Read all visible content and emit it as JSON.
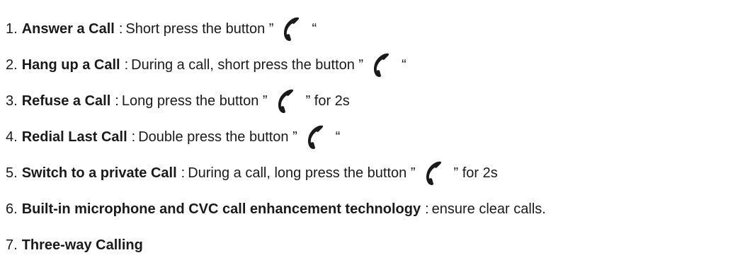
{
  "items": [
    {
      "number": "1.",
      "title": "Answer a Call",
      "separator": ":",
      "text_before_icon": "Short press the button ”",
      "icon": "phone-handset-icon",
      "text_after_icon": "“"
    },
    {
      "number": "2.",
      "title": "Hang up a Call",
      "separator": ":",
      "text_before_icon": "During a call, short press the button ”",
      "icon": "phone-handset-icon",
      "text_after_icon": "“"
    },
    {
      "number": "3.",
      "title": "Refuse a Call",
      "separator": ":",
      "text_before_icon": "Long press the button ”",
      "icon": "phone-handset-icon",
      "text_after_icon": "” for 2s"
    },
    {
      "number": "4.",
      "title": "Redial Last Call",
      "separator": ":",
      "text_before_icon": "Double press the button ”",
      "icon": "phone-handset-icon",
      "text_after_icon": "“"
    },
    {
      "number": "5.",
      "title": "Switch to a private Call",
      "separator": ":",
      "text_before_icon": "During a call, long press the button ”",
      "icon": "phone-handset-icon",
      "text_after_icon": "” for 2s"
    },
    {
      "number": "6.",
      "title": "Built-in microphone and CVC call enhancement technology",
      "separator": ":",
      "text_before_icon": "ensure clear calls.",
      "icon": "",
      "text_after_icon": ""
    },
    {
      "number": "7.",
      "title": "Three-way Calling",
      "separator": "",
      "text_before_icon": "",
      "icon": "",
      "text_after_icon": ""
    }
  ],
  "colors": {
    "text": "#1a1a1a",
    "icon": "#1a1a1a",
    "background": "#ffffff"
  }
}
